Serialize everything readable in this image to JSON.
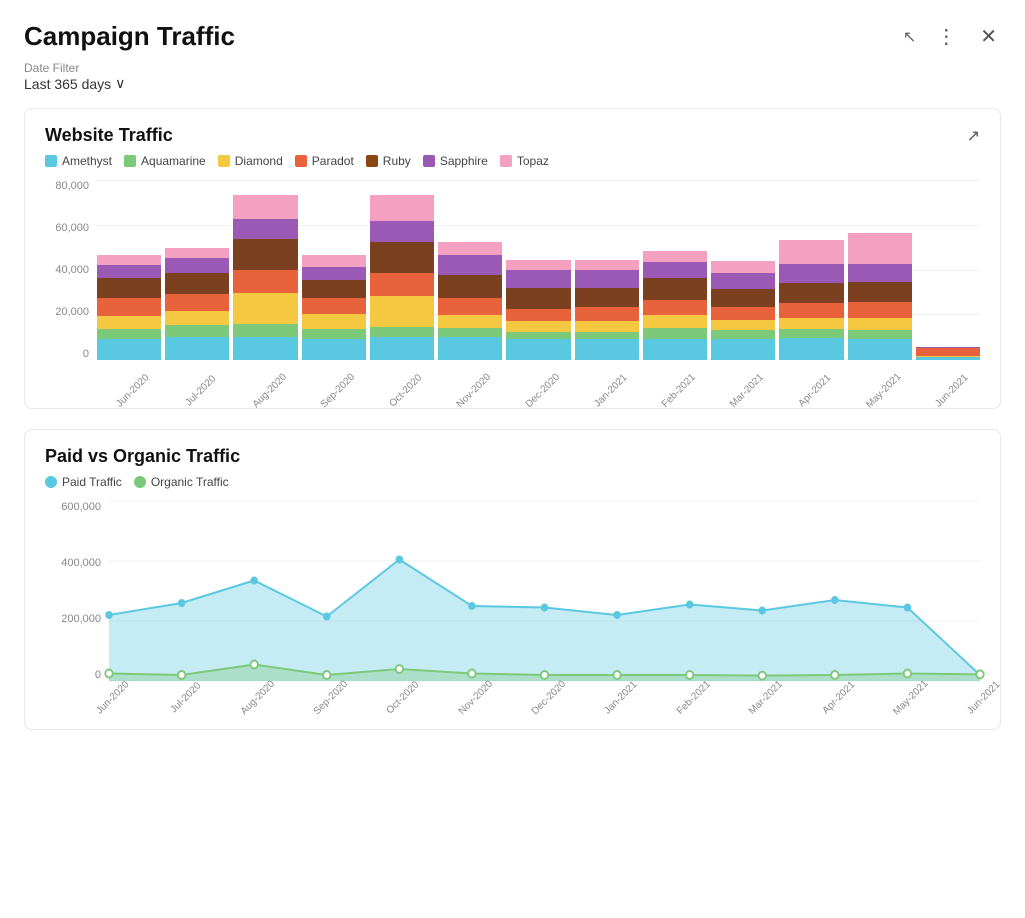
{
  "header": {
    "title": "Campaign Traffic",
    "more_icon": "⋮",
    "close_icon": "✕"
  },
  "date_filter": {
    "label": "Date Filter",
    "value": "Last 365 days",
    "chevron": "∨"
  },
  "website_traffic": {
    "title": "Website Traffic",
    "expand_icon": "↗",
    "legend": [
      {
        "name": "Amethyst",
        "color": "#5AC8E0"
      },
      {
        "name": "Aquamarine",
        "color": "#7DC97A"
      },
      {
        "name": "Diamond",
        "color": "#F5C842"
      },
      {
        "name": "Paradot",
        "color": "#E8633C"
      },
      {
        "name": "Ruby",
        "color": "#8B4513"
      },
      {
        "name": "Sapphire",
        "color": "#9B59B6"
      },
      {
        "name": "Topaz",
        "color": "#F4A0C0"
      }
    ],
    "x_labels": [
      "Jun-2020",
      "Jul-2020",
      "Aug-2020",
      "Sep-2020",
      "Oct-2020",
      "Nov-2020",
      "Dec-2020",
      "Jan-2021",
      "Feb-2021",
      "Mar-2021",
      "Apr-2021",
      "May-2021",
      "Jun-2021"
    ],
    "y_labels": [
      "80,000",
      "60,000",
      "40,000",
      "20,000",
      "0"
    ],
    "bars": [
      {
        "amethyst": 8000,
        "aquamarine": 4000,
        "diamond": 5000,
        "paradot": 7000,
        "ruby": 8000,
        "sapphire": 5000,
        "topaz": 4000
      },
      {
        "amethyst": 9000,
        "aquamarine": 4500,
        "diamond": 5500,
        "paradot": 6500,
        "ruby": 8500,
        "sapphire": 5500,
        "topaz": 4000
      },
      {
        "amethyst": 9000,
        "aquamarine": 5000,
        "diamond": 12000,
        "paradot": 9000,
        "ruby": 12000,
        "sapphire": 8000,
        "topaz": 9000
      },
      {
        "amethyst": 8000,
        "aquamarine": 4000,
        "diamond": 6000,
        "paradot": 6000,
        "ruby": 7000,
        "sapphire": 5000,
        "topaz": 5000
      },
      {
        "amethyst": 9000,
        "aquamarine": 4000,
        "diamond": 12000,
        "paradot": 9000,
        "ruby": 12000,
        "sapphire": 8000,
        "topaz": 10000
      },
      {
        "amethyst": 9000,
        "aquamarine": 3500,
        "diamond": 5000,
        "paradot": 6500,
        "ruby": 9000,
        "sapphire": 8000,
        "topaz": 5000
      },
      {
        "amethyst": 8000,
        "aquamarine": 3000,
        "diamond": 4000,
        "paradot": 5000,
        "ruby": 8000,
        "sapphire": 7000,
        "topaz": 4000
      },
      {
        "amethyst": 8000,
        "aquamarine": 3000,
        "diamond": 4000,
        "paradot": 5500,
        "ruby": 7500,
        "sapphire": 7000,
        "topaz": 4000
      },
      {
        "amethyst": 8000,
        "aquamarine": 4500,
        "diamond": 5000,
        "paradot": 6000,
        "ruby": 8500,
        "sapphire": 6000,
        "topaz": 4500
      },
      {
        "amethyst": 8000,
        "aquamarine": 3500,
        "diamond": 4000,
        "paradot": 5000,
        "ruby": 7000,
        "sapphire": 6500,
        "topaz": 4500
      },
      {
        "amethyst": 8500,
        "aquamarine": 3500,
        "diamond": 4500,
        "paradot": 5500,
        "ruby": 8000,
        "sapphire": 7500,
        "topaz": 9000
      },
      {
        "amethyst": 8000,
        "aquamarine": 3500,
        "diamond": 5000,
        "paradot": 6000,
        "ruby": 8000,
        "sapphire": 7000,
        "topaz": 12000
      },
      {
        "amethyst": 1000,
        "aquamarine": 200,
        "diamond": 300,
        "paradot": 3000,
        "ruby": 300,
        "sapphire": 200,
        "topaz": 200
      }
    ]
  },
  "paid_organic": {
    "title": "Paid vs Organic Traffic",
    "legend": [
      {
        "name": "Paid Traffic",
        "color": "#5AC8E0"
      },
      {
        "name": "Organic Traffic",
        "color": "#7DC97A"
      }
    ],
    "x_labels": [
      "Jun-2020",
      "Jul-2020",
      "Aug-2020",
      "Sep-2020",
      "Oct-2020",
      "Nov-2020",
      "Dec-2020",
      "Jan-2021",
      "Feb-2021",
      "Mar-2021",
      "Apr-2021",
      "May-2021",
      "Jun-2021"
    ],
    "y_labels": [
      "600,000",
      "400,000",
      "200,000",
      "0"
    ],
    "paid_values": [
      220000,
      260000,
      335000,
      215000,
      405000,
      250000,
      245000,
      220000,
      255000,
      235000,
      270000,
      245000,
      20000
    ],
    "organic_values": [
      25000,
      20000,
      55000,
      20000,
      40000,
      25000,
      20000,
      20000,
      20000,
      18000,
      20000,
      25000,
      22000
    ]
  }
}
